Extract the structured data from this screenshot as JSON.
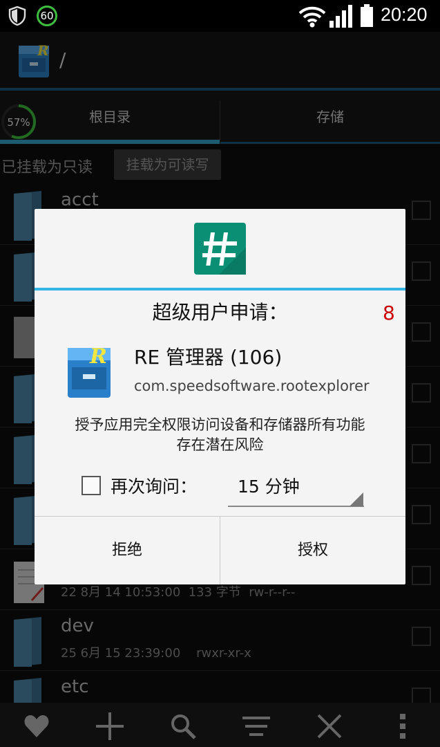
{
  "status_bar": {
    "icons": [
      "shield-icon",
      "wifi-icon",
      "signal-icon",
      "battery-icon"
    ],
    "badge": "60",
    "time": "20:20"
  },
  "app_bar": {
    "path": "/"
  },
  "tabs": [
    {
      "label": "根目录",
      "active": true
    },
    {
      "label": "存储",
      "active": false
    }
  ],
  "storage_usage": "57%",
  "mount": {
    "status": "已挂载为只读",
    "button": "挂载为可读写"
  },
  "files": [
    {
      "name": "acct",
      "meta": ""
    },
    {
      "name": "",
      "meta": "22 8月 14 10:53:00  133 字节  rw-r--r--"
    },
    {
      "name": "dev",
      "meta": "25 6月 15 23:39:00    rwxr-xr-x"
    },
    {
      "name": "etc",
      "meta": ""
    }
  ],
  "bottom_bar": [
    "heart-icon",
    "plus-icon",
    "search-icon",
    "sort-icon",
    "close-icon",
    "more-icon"
  ],
  "dialog": {
    "title": "超级用户申请：",
    "countdown": "8",
    "app_name": "RE 管理器 (106)",
    "package": "com.speedsoftware.rootexplorer",
    "warning_line1": "授予应用完全权限访问设备和存储器所有功能",
    "warning_line2": "存在潜在风险",
    "ask_again_label": "再次询问：",
    "ask_again_checked": false,
    "duration_value": "15 分钟",
    "deny_label": "拒绝",
    "grant_label": "授权"
  },
  "colors": {
    "accent": "#33b5e5",
    "su_icon": "#0b8f74",
    "countdown": "#cc0000"
  }
}
